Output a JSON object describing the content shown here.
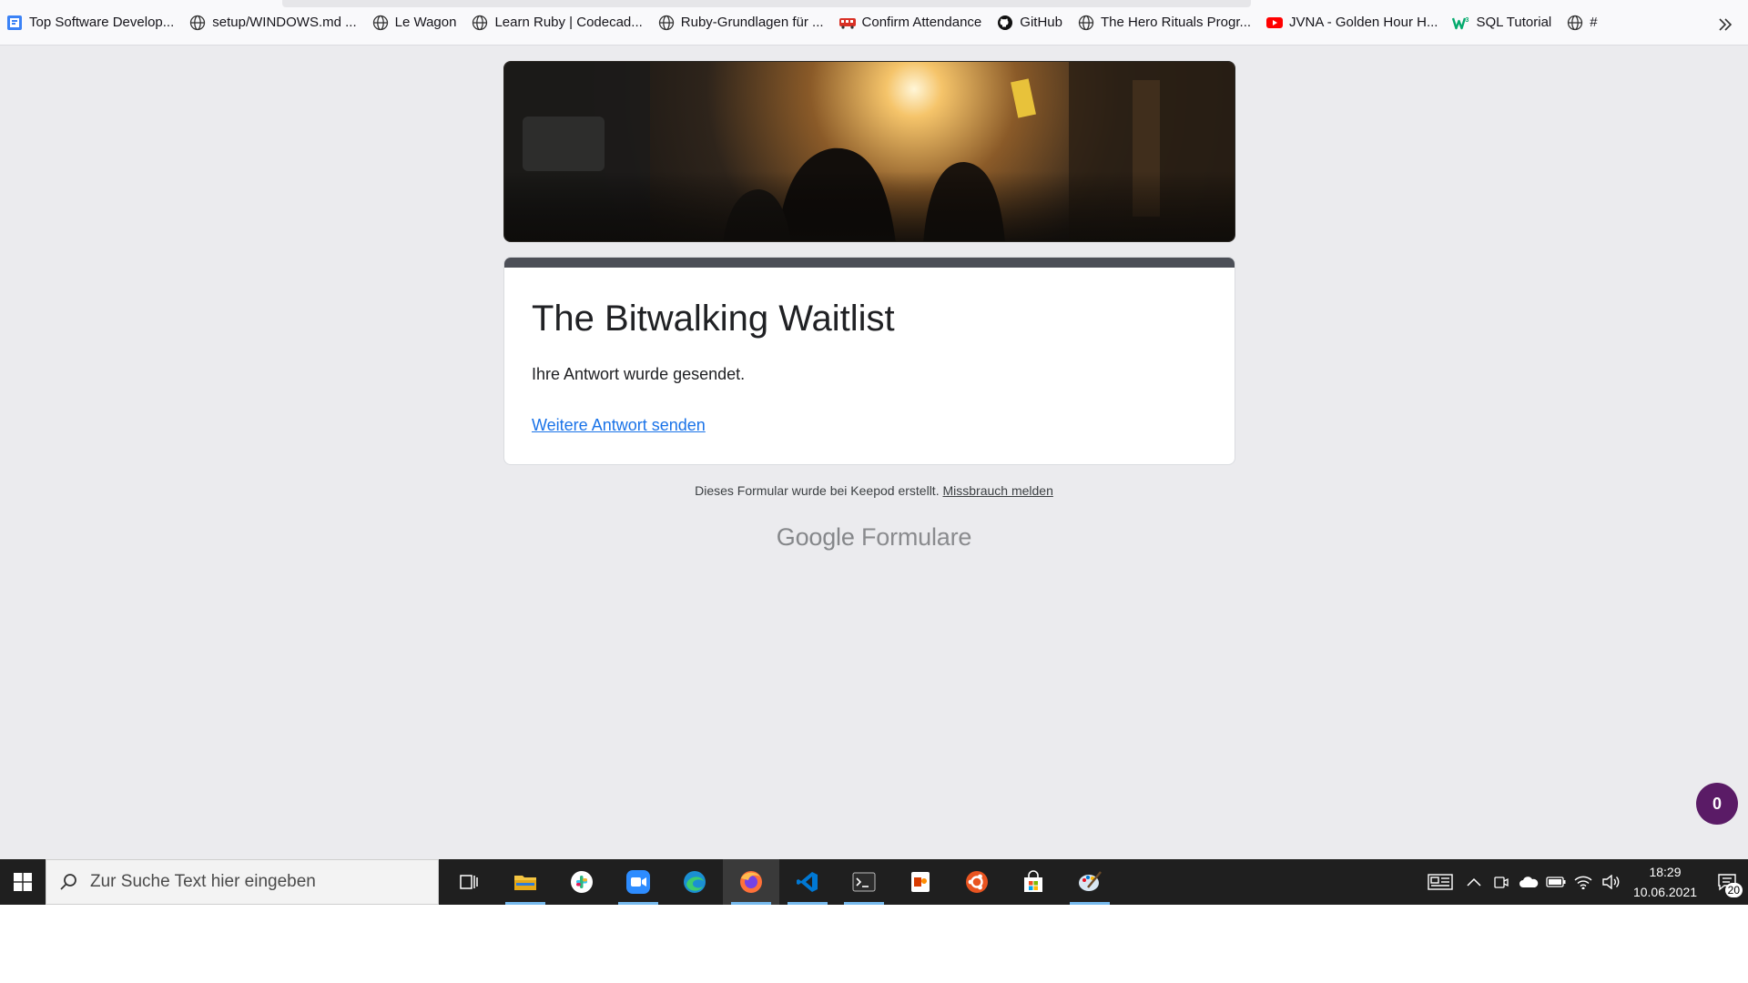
{
  "bookmarks": [
    {
      "label": "Top Software Develop...",
      "icon": "document-blue-icon"
    },
    {
      "label": "setup/WINDOWS.md ...",
      "icon": "globe-icon"
    },
    {
      "label": "Le Wagon",
      "icon": "globe-icon"
    },
    {
      "label": "Learn Ruby | Codecad...",
      "icon": "globe-icon"
    },
    {
      "label": "Ruby-Grundlagen für ...",
      "icon": "globe-icon"
    },
    {
      "label": "Confirm Attendance",
      "icon": "bus-icon"
    },
    {
      "label": "GitHub",
      "icon": "github-icon"
    },
    {
      "label": "The Hero Rituals Progr...",
      "icon": "globe-icon"
    },
    {
      "label": "JVNA - Golden Hour H...",
      "icon": "youtube-icon"
    },
    {
      "label": "SQL Tutorial",
      "icon": "w3schools-icon"
    },
    {
      "label": "#",
      "icon": "globe-icon"
    }
  ],
  "form": {
    "title": "The Bitwalking Waitlist",
    "message": "Ihre Antwort wurde gesendet.",
    "link": "Weitere Antwort senden",
    "accent_color": "#4c4f57"
  },
  "footer": {
    "note": "Dieses Formular wurde bei Keepod erstellt.",
    "report_link": "Missbrauch melden",
    "brand_google": "Google",
    "brand_product": "Formulare"
  },
  "fab": {
    "count": "0",
    "color": "#5a1b66"
  },
  "taskbar": {
    "search_placeholder": "Zur Suche Text hier eingeben",
    "apps": [
      "task-view-icon",
      "file-explorer-icon",
      "slack-icon",
      "zoom-icon",
      "edge-icon",
      "firefox-icon",
      "vscode-icon",
      "terminal-icon",
      "office-icon",
      "ubuntu-icon",
      "store-icon",
      "paint-icon"
    ],
    "time": "18:29",
    "date": "10.06.2021",
    "notifications": "20"
  }
}
